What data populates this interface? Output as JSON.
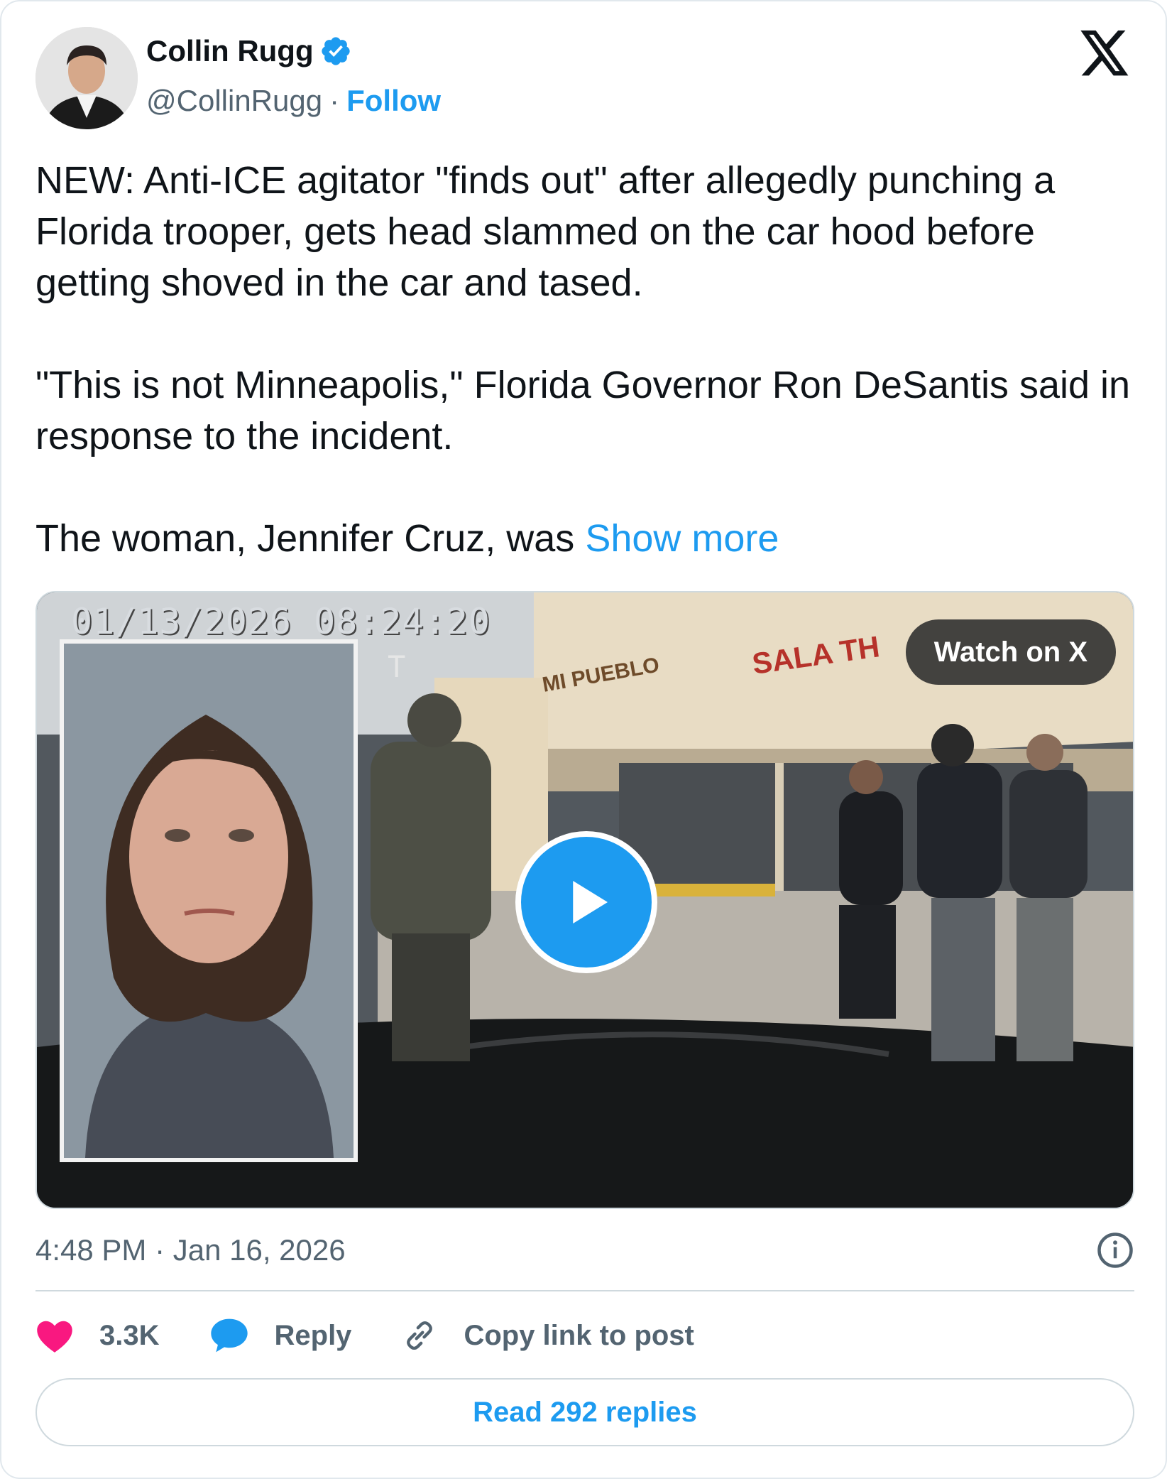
{
  "author": {
    "name": "Collin Rugg",
    "handle": "@CollinRugg",
    "separator": "·",
    "follow_label": "Follow"
  },
  "tweet": {
    "paragraph1": "NEW: Anti-ICE agitator \"finds out\" after allegedly punching a Florida trooper, gets head slammed on the car hood before getting shoved in the car and tased.",
    "paragraph2": "\"This is not Minneapolis,\" Florida Governor Ron DeSantis said in response to the incident.",
    "paragraph3": "The woman, Jennifer Cruz, was ",
    "show_more_label": "Show more"
  },
  "media": {
    "timestamp_overlay": "01/13/2026 08:24:20",
    "t_mark": "T",
    "watch_label": "Watch on X",
    "storefront_sign_1": "MI PUEBLO",
    "storefront_sign_2": "SALA TH"
  },
  "meta": {
    "time": "4:48 PM · Jan 16, 2026"
  },
  "actions": {
    "likes": "3.3K",
    "reply_label": "Reply",
    "copy_label": "Copy link to post"
  },
  "read_replies_label": "Read 292 replies",
  "colors": {
    "accent": "#1d9bf0",
    "like": "#f91880",
    "text": "#0f1419",
    "secondary": "#536471"
  },
  "icons": [
    "x-logo-icon",
    "verified-badge-icon",
    "play-icon",
    "info-icon",
    "heart-icon",
    "reply-bubble-icon",
    "link-icon"
  ]
}
